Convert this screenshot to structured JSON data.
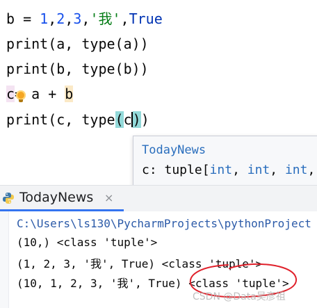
{
  "editor": {
    "lines": [
      {
        "name": "line-b-assign",
        "tokens": [
          {
            "t": "b = ",
            "c": ""
          },
          {
            "t": "1",
            "c": "num"
          },
          {
            "t": ",",
            "c": ""
          },
          {
            "t": "2",
            "c": "num"
          },
          {
            "t": ",",
            "c": ""
          },
          {
            "t": "3",
            "c": "num"
          },
          {
            "t": ",",
            "c": ""
          },
          {
            "t": "'我'",
            "c": "str"
          },
          {
            "t": ",",
            "c": ""
          },
          {
            "t": "True",
            "c": "kw"
          }
        ]
      },
      {
        "name": "line-print-a",
        "tokens": [
          {
            "t": "print(a, type(a))",
            "c": ""
          }
        ]
      },
      {
        "name": "line-print-b",
        "tokens": [
          {
            "t": "print(b, type(b))",
            "c": ""
          }
        ]
      },
      {
        "name": "line-c-assign",
        "tokens": [
          {
            "t": "c",
            "c": "hl-c"
          },
          {
            "t": "= a + ",
            "c": ""
          },
          {
            "t": "b",
            "c": "hl-b"
          }
        ]
      },
      {
        "name": "line-print-c",
        "tokens": [
          {
            "t": "print(c, type",
            "c": ""
          },
          {
            "t": "(",
            "c": "hl-paren"
          },
          {
            "t": "c",
            "c": ""
          },
          {
            "t": "CARET",
            "c": "caret"
          },
          {
            "t": ")",
            "c": "hl-paren"
          },
          {
            "t": ")",
            "c": ""
          }
        ]
      }
    ]
  },
  "popup": {
    "title": "TodayNews",
    "sig_prefix": "c: tuple[",
    "sig_types": [
      "int",
      "int",
      "int"
    ],
    "sig_rest": ", "
  },
  "run": {
    "tab_label": "TodayNews",
    "close_glyph": "×",
    "icon": "python-icon"
  },
  "console": {
    "lines": [
      "C:\\Users\\ls130\\PycharmProjects\\pythonProject",
      "(10,) <class 'tuple'>",
      "(1, 2, 3, '我', True) <class 'tuple'>",
      "(10, 1, 2, 3, '我', True) <class 'tuple'>"
    ]
  },
  "annotation": {
    "color": "#e0212b"
  },
  "watermark": "CSDN @Data吴彦祖"
}
